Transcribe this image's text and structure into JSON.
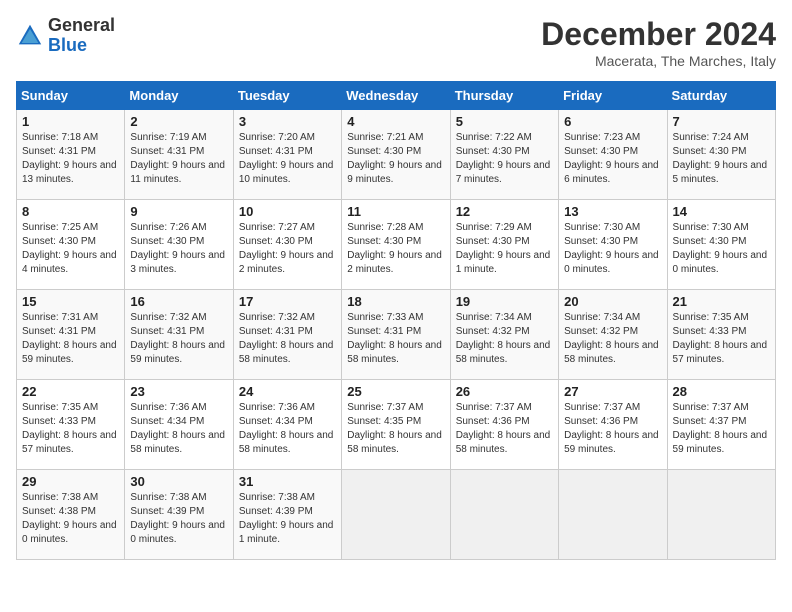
{
  "logo": {
    "general": "General",
    "blue": "Blue"
  },
  "title": "December 2024",
  "location": "Macerata, The Marches, Italy",
  "weekdays": [
    "Sunday",
    "Monday",
    "Tuesday",
    "Wednesday",
    "Thursday",
    "Friday",
    "Saturday"
  ],
  "weeks": [
    [
      {
        "day": "1",
        "sunrise": "7:18 AM",
        "sunset": "4:31 PM",
        "daylight": "9 hours and 13 minutes."
      },
      {
        "day": "2",
        "sunrise": "7:19 AM",
        "sunset": "4:31 PM",
        "daylight": "9 hours and 11 minutes."
      },
      {
        "day": "3",
        "sunrise": "7:20 AM",
        "sunset": "4:31 PM",
        "daylight": "9 hours and 10 minutes."
      },
      {
        "day": "4",
        "sunrise": "7:21 AM",
        "sunset": "4:30 PM",
        "daylight": "9 hours and 9 minutes."
      },
      {
        "day": "5",
        "sunrise": "7:22 AM",
        "sunset": "4:30 PM",
        "daylight": "9 hours and 7 minutes."
      },
      {
        "day": "6",
        "sunrise": "7:23 AM",
        "sunset": "4:30 PM",
        "daylight": "9 hours and 6 minutes."
      },
      {
        "day": "7",
        "sunrise": "7:24 AM",
        "sunset": "4:30 PM",
        "daylight": "9 hours and 5 minutes."
      }
    ],
    [
      {
        "day": "8",
        "sunrise": "7:25 AM",
        "sunset": "4:30 PM",
        "daylight": "9 hours and 4 minutes."
      },
      {
        "day": "9",
        "sunrise": "7:26 AM",
        "sunset": "4:30 PM",
        "daylight": "9 hours and 3 minutes."
      },
      {
        "day": "10",
        "sunrise": "7:27 AM",
        "sunset": "4:30 PM",
        "daylight": "9 hours and 2 minutes."
      },
      {
        "day": "11",
        "sunrise": "7:28 AM",
        "sunset": "4:30 PM",
        "daylight": "9 hours and 2 minutes."
      },
      {
        "day": "12",
        "sunrise": "7:29 AM",
        "sunset": "4:30 PM",
        "daylight": "9 hours and 1 minute."
      },
      {
        "day": "13",
        "sunrise": "7:30 AM",
        "sunset": "4:30 PM",
        "daylight": "9 hours and 0 minutes."
      },
      {
        "day": "14",
        "sunrise": "7:30 AM",
        "sunset": "4:30 PM",
        "daylight": "9 hours and 0 minutes."
      }
    ],
    [
      {
        "day": "15",
        "sunrise": "7:31 AM",
        "sunset": "4:31 PM",
        "daylight": "8 hours and 59 minutes."
      },
      {
        "day": "16",
        "sunrise": "7:32 AM",
        "sunset": "4:31 PM",
        "daylight": "8 hours and 59 minutes."
      },
      {
        "day": "17",
        "sunrise": "7:32 AM",
        "sunset": "4:31 PM",
        "daylight": "8 hours and 58 minutes."
      },
      {
        "day": "18",
        "sunrise": "7:33 AM",
        "sunset": "4:31 PM",
        "daylight": "8 hours and 58 minutes."
      },
      {
        "day": "19",
        "sunrise": "7:34 AM",
        "sunset": "4:32 PM",
        "daylight": "8 hours and 58 minutes."
      },
      {
        "day": "20",
        "sunrise": "7:34 AM",
        "sunset": "4:32 PM",
        "daylight": "8 hours and 58 minutes."
      },
      {
        "day": "21",
        "sunrise": "7:35 AM",
        "sunset": "4:33 PM",
        "daylight": "8 hours and 57 minutes."
      }
    ],
    [
      {
        "day": "22",
        "sunrise": "7:35 AM",
        "sunset": "4:33 PM",
        "daylight": "8 hours and 57 minutes."
      },
      {
        "day": "23",
        "sunrise": "7:36 AM",
        "sunset": "4:34 PM",
        "daylight": "8 hours and 58 minutes."
      },
      {
        "day": "24",
        "sunrise": "7:36 AM",
        "sunset": "4:34 PM",
        "daylight": "8 hours and 58 minutes."
      },
      {
        "day": "25",
        "sunrise": "7:37 AM",
        "sunset": "4:35 PM",
        "daylight": "8 hours and 58 minutes."
      },
      {
        "day": "26",
        "sunrise": "7:37 AM",
        "sunset": "4:36 PM",
        "daylight": "8 hours and 58 minutes."
      },
      {
        "day": "27",
        "sunrise": "7:37 AM",
        "sunset": "4:36 PM",
        "daylight": "8 hours and 59 minutes."
      },
      {
        "day": "28",
        "sunrise": "7:37 AM",
        "sunset": "4:37 PM",
        "daylight": "8 hours and 59 minutes."
      }
    ],
    [
      {
        "day": "29",
        "sunrise": "7:38 AM",
        "sunset": "4:38 PM",
        "daylight": "9 hours and 0 minutes."
      },
      {
        "day": "30",
        "sunrise": "7:38 AM",
        "sunset": "4:39 PM",
        "daylight": "9 hours and 0 minutes."
      },
      {
        "day": "31",
        "sunrise": "7:38 AM",
        "sunset": "4:39 PM",
        "daylight": "9 hours and 1 minute."
      },
      null,
      null,
      null,
      null
    ]
  ]
}
